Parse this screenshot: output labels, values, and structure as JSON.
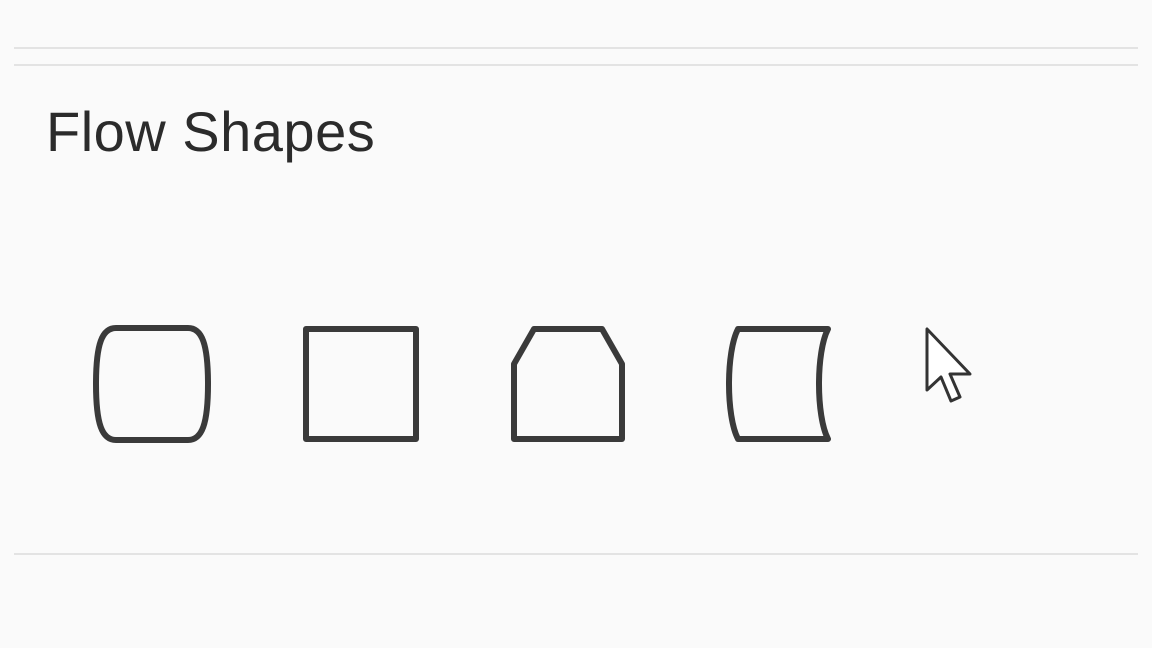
{
  "section": {
    "title": "Flow Shapes"
  },
  "shapes": [
    {
      "name": "terminator-shape",
      "icon": "terminator-icon"
    },
    {
      "name": "process-shape",
      "icon": "process-icon"
    },
    {
      "name": "loop-limit-shape",
      "icon": "loop-limit-icon"
    },
    {
      "name": "stored-data-shape",
      "icon": "stored-data-icon"
    }
  ],
  "colors": {
    "background": "#fafafa",
    "stroke": "#3a3a3a",
    "divider": "#e3e3e3",
    "title": "#2b2b2b"
  }
}
